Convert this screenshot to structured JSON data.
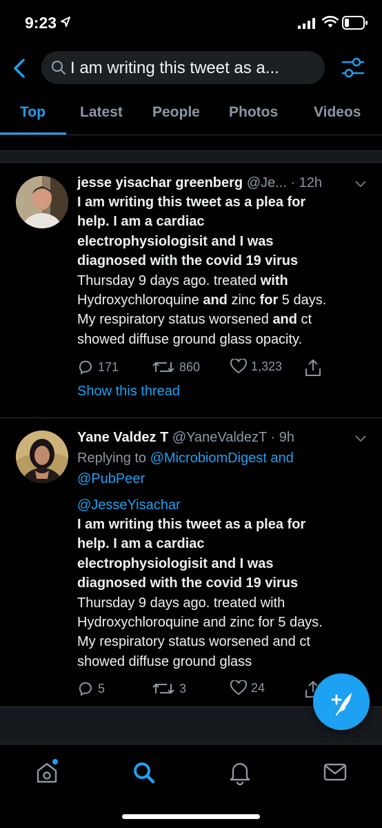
{
  "status_bar": {
    "time": "9:23"
  },
  "search": {
    "query": "I am writing this tweet as a..."
  },
  "tabs": [
    {
      "label": "Top",
      "active": true
    },
    {
      "label": "Latest"
    },
    {
      "label": "People"
    },
    {
      "label": "Photos"
    },
    {
      "label": "Videos"
    }
  ],
  "tweets": [
    {
      "name": "jesse yisachar greenberg",
      "handle": "@Je...",
      "time": "· 12h",
      "lines": [
        [
          {
            "t": "I am writing this tweet as a plea for",
            "b": true
          }
        ],
        [
          {
            "t": "help. I am a  cardiac",
            "b": true
          }
        ],
        [
          {
            "t": "electrophysiologisit and I was",
            "b": true
          }
        ],
        [
          {
            "t": "diagnosed with the covid 19 virus",
            "b": true
          }
        ],
        [
          {
            "t": "Thursday 9 days ago. treated ",
            "b": false
          },
          {
            "t": "with",
            "b": true
          }
        ],
        [
          {
            "t": "Hydroxychloroquine ",
            "b": false
          },
          {
            "t": "and",
            "b": true
          },
          {
            "t": " zinc ",
            "b": false
          },
          {
            "t": "for",
            "b": true
          },
          {
            "t": " 5 days.",
            "b": false
          }
        ],
        [
          {
            "t": "My respiratory status worsened ",
            "b": false
          },
          {
            "t": "and",
            "b": true
          },
          {
            "t": " ct",
            "b": false
          }
        ],
        [
          {
            "t": "showed  diffuse ground glass opacity.",
            "b": false
          }
        ]
      ],
      "replies": "171",
      "retweets": "860",
      "likes": "1,323",
      "thread_link": "Show this thread"
    },
    {
      "name": "Yane Valdez T",
      "handle": "@YaneValdezT",
      "time": "· 9h",
      "replying_prefix": "Replying to",
      "replying_to": "@MicrobiomDigest and",
      "replying_to_2": "@PubPeer",
      "mention": "@JesseYisachar",
      "lines": [
        [
          {
            "t": "I am writing this tweet as a plea for",
            "b": true
          }
        ],
        [
          {
            "t": "help. I am a  cardiac",
            "b": true
          }
        ],
        [
          {
            "t": "electrophysiologisit and I was",
            "b": true
          }
        ],
        [
          {
            "t": "diagnosed with the covid 19 virus",
            "b": true
          }
        ],
        [
          {
            "t": "Thursday 9 days ago. treated with",
            "b": false
          }
        ],
        [
          {
            "t": "Hydroxychloroquine and zinc for 5 days.",
            "b": false
          }
        ],
        [
          {
            "t": "My respiratory status worsened and ct",
            "b": false
          }
        ],
        [
          {
            "t": "showed  diffuse ground glass",
            "b": false
          }
        ]
      ],
      "replies": "5",
      "retweets": "3",
      "likes": "24"
    }
  ],
  "colors": {
    "accent": "#1da1f2",
    "background": "#000000",
    "muted": "#8b98a5"
  },
  "icons": [
    "back-chevron-icon",
    "search-icon",
    "filter-icon",
    "reply-icon",
    "retweet-icon",
    "like-icon",
    "share-icon",
    "compose-icon",
    "home-icon",
    "explore-icon",
    "notifications-icon",
    "messages-icon"
  ]
}
